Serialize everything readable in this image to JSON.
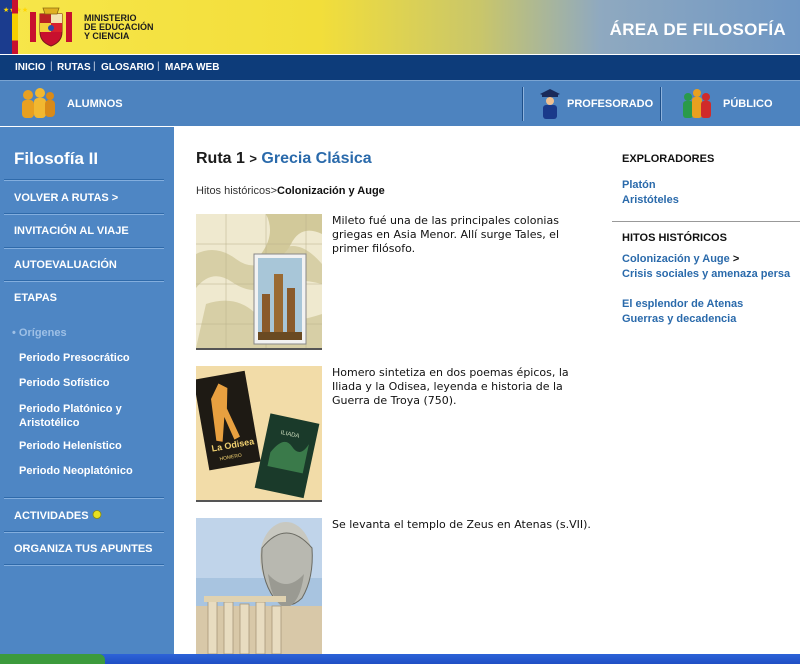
{
  "header": {
    "ministry_lines": [
      "MINISTERIO",
      "DE EDUCACIÓN",
      "Y CIENCIA"
    ],
    "area_title": "ÁREA DE FILOSOFÍA"
  },
  "topnav": {
    "items": [
      "INICIO",
      "RUTAS",
      "GLOSARIO",
      "MAPA WEB"
    ],
    "separator": "|"
  },
  "audience": {
    "alumnos": "ALUMNOS",
    "profesorado": "PROFESORADO",
    "publico": "PÚBLICO"
  },
  "sidebar": {
    "title": "Filosofía II",
    "volver": "VOLVER A RUTAS >",
    "invitacion": "INVITACIÓN AL VIAJE",
    "autoevaluacion": "AUTOEVALUACIÓN",
    "etapas": "ETAPAS",
    "etapa_items": [
      "Orígenes",
      "Periodo Presocrático",
      "Periodo Sofístico",
      "Periodo Platónico y Aristotélico",
      "Periodo Helenístico",
      "Periodo Neoplatónico"
    ],
    "actividades": "ACTIVIDADES",
    "organiza": "ORGANIZA TUS APUNTES"
  },
  "main": {
    "ruta": "Ruta 1",
    "arrow": ">",
    "page_title": "Grecia Clásica",
    "subcrumb_parent": "Hitos históricos",
    "subcrumb_sep": ">",
    "subcrumb_current": "Colonización y Auge",
    "entries": [
      "Mileto fué una de las principales colonias griegas en Asia Menor. Allí surge Tales, el primer filósofo.",
      "Homero sintetiza en dos poemas épicos, la Iliada y la Odisea, leyenda e historia de la Guerra de Troya (750).",
      "Se levanta el templo de Zeus en Atenas (s.VII)."
    ],
    "book_title": "La Odisea",
    "book_author": "HOMERO",
    "book2_title": "ILIADA"
  },
  "right": {
    "exploradores_title": "EXPLORADORES",
    "exploradores": [
      "Platón",
      "Aristóteles"
    ],
    "hitos_title": "HITOS HISTÓRICOS",
    "hitos": [
      "Colonización y Auge",
      "Crisis sociales y amenaza persa",
      "El esplendor de Atenas",
      "Guerras y decadencia"
    ],
    "current_marker": ">"
  },
  "colors": {
    "nav_dark": "#0d3c7a",
    "sidebar": "#4e86c4",
    "link": "#2a6aab"
  }
}
